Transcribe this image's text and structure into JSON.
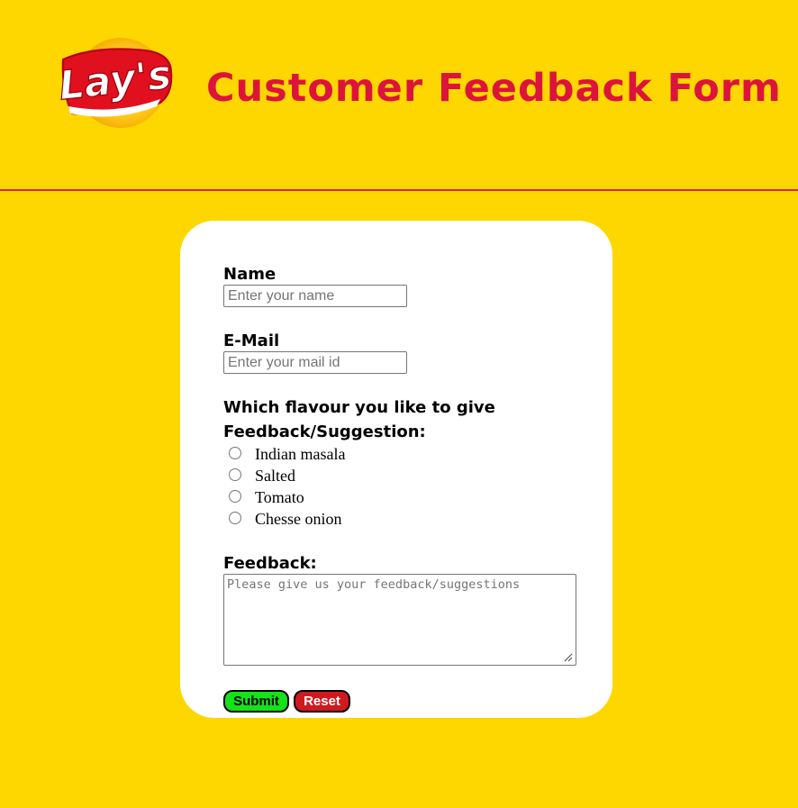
{
  "header": {
    "logo_text": "Lay's",
    "title": "Customer Feedback Form"
  },
  "form": {
    "name": {
      "label": "Name",
      "placeholder": "Enter your name",
      "value": ""
    },
    "email": {
      "label": "E-Mail",
      "placeholder": "Enter your mail id",
      "value": ""
    },
    "flavour": {
      "label_line1": "Which flavour you like to give",
      "label_line2": "Feedback/Suggestion:",
      "options": [
        {
          "label": "Indian masala",
          "checked": false
        },
        {
          "label": "Salted",
          "checked": false
        },
        {
          "label": "Tomato",
          "checked": false
        },
        {
          "label": "Chesse onion",
          "checked": false
        }
      ]
    },
    "feedback": {
      "label": "Feedback:",
      "placeholder": "Please give us your feedback/suggestions",
      "value": ""
    },
    "buttons": {
      "submit_label": "Submit",
      "reset_label": "Reset"
    }
  },
  "colors": {
    "background": "#FFD700",
    "title": "#DC143C",
    "divider": "#E0212E",
    "submit": "#12E418",
    "reset": "#D0191F"
  }
}
